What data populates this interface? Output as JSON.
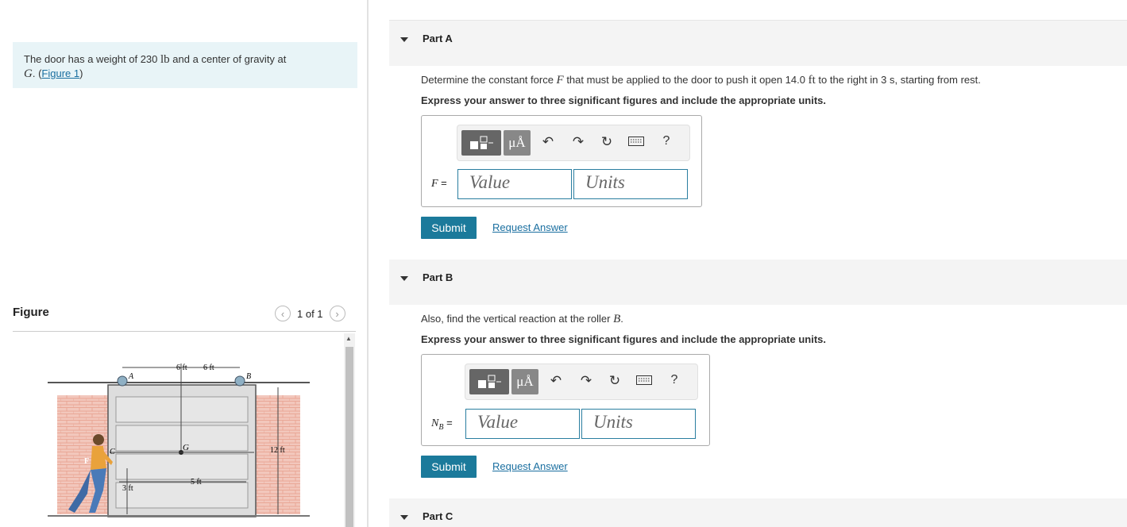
{
  "problem": {
    "text_prefix": "The door has a weight of 230 ",
    "text_unit": "lb",
    "text_mid": " and a center of gravity at",
    "text_G": "G",
    "text_dot": ". (",
    "figure_link": "Figure 1",
    "text_end": ")"
  },
  "figure": {
    "title": "Figure",
    "pager": "1 of 1",
    "prev_icon": "chevron-left-icon",
    "next_icon": "chevron-right-icon",
    "labels": {
      "A": "A",
      "B": "B",
      "C": "C",
      "G": "G",
      "F": "F",
      "dim_6ft_a": "6 ft",
      "dim_6ft_b": "6 ft",
      "dim_12ft": "12 ft",
      "dim_3ft": "3 ft",
      "dim_5ft": "5 ft"
    }
  },
  "partA": {
    "title": "Part A",
    "q_pre": "Determine the constant force ",
    "q_var": "F",
    "q_mid": " that must be applied to the door to push it open 14.0 ",
    "q_unit": "ft",
    "q_end": " to the right in 3 s, starting from rest.",
    "instruction": "Express your answer to three significant figures and include the appropriate units.",
    "var_label": "F",
    "eq": " =",
    "value_placeholder": "Value",
    "units_placeholder": "Units",
    "submit": "Submit",
    "request": "Request Answer"
  },
  "partB": {
    "title": "Part B",
    "q_pre": "Also, find the vertical reaction at the roller ",
    "q_var": "B",
    "q_end": ".",
    "instruction": "Express your answer to three significant figures and include the appropriate units.",
    "var_label": "N",
    "var_sub": "B",
    "eq": " =",
    "value_placeholder": "Value",
    "units_placeholder": "Units",
    "submit": "Submit",
    "request": "Request Answer"
  },
  "partC": {
    "title": "Part C"
  },
  "toolbar": {
    "units_btn": "μÅ",
    "help": "?",
    "icons": [
      "templates-icon",
      "units-icon",
      "undo-icon",
      "redo-icon",
      "reset-icon",
      "keyboard-icon",
      "help-icon"
    ]
  }
}
